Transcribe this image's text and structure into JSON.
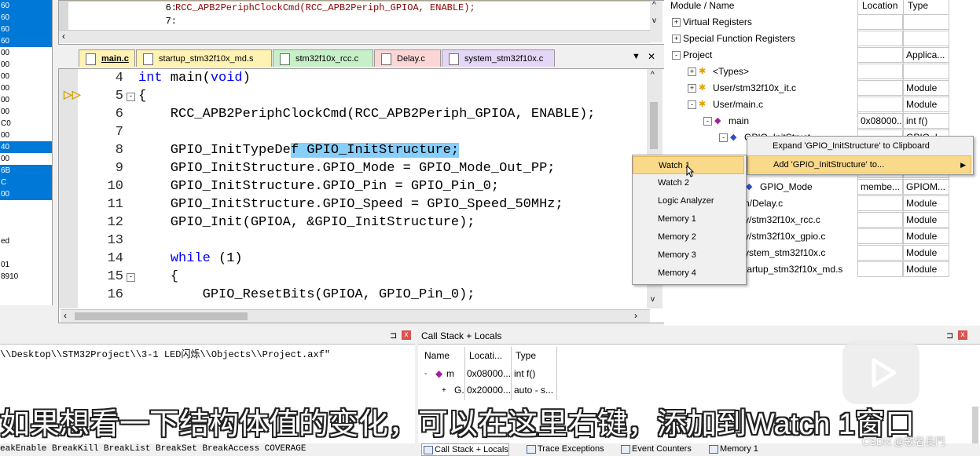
{
  "left_panel": {
    "rows": [
      {
        "text": "60",
        "selected": true
      },
      {
        "text": "60",
        "selected": true
      },
      {
        "text": "60",
        "selected": true
      },
      {
        "text": "60",
        "selected": true
      },
      {
        "text": "00",
        "selected": false
      },
      {
        "text": "00",
        "selected": false
      },
      {
        "text": "00",
        "selected": false
      },
      {
        "text": "00",
        "selected": false
      },
      {
        "text": "00",
        "selected": false
      },
      {
        "text": "00",
        "selected": false
      },
      {
        "text": "C0",
        "selected": false
      },
      {
        "text": "00",
        "selected": false
      },
      {
        "text": "40",
        "selected": true
      },
      {
        "text": "00",
        "selected": false
      },
      {
        "text": "6B",
        "selected": true
      },
      {
        "text": "C",
        "selected": true
      },
      {
        "text": "00",
        "selected": true
      },
      {
        "text": "",
        "selected": false
      },
      {
        "text": "",
        "selected": false
      },
      {
        "text": "",
        "selected": false
      },
      {
        "text": "ed",
        "selected": false
      },
      {
        "text": "",
        "selected": false
      },
      {
        "text": "01",
        "selected": false
      },
      {
        "text": "8910",
        "selected": false
      }
    ]
  },
  "top_editor": {
    "lines": [
      {
        "num": "6:",
        "code": "RCC_APB2PeriphClockCmd(RCC_APB2Periph_GPIOA, ENABLE);"
      },
      {
        "num": "7:",
        "code": ""
      }
    ]
  },
  "tabs": [
    {
      "label": "main.c",
      "color": "#fff2b3",
      "active": true
    },
    {
      "label": "startup_stm32f10x_md.s",
      "color": "#fff2b3",
      "active": false
    },
    {
      "label": "stm32f10x_rcc.c",
      "color": "#c8f0c8",
      "active": false
    },
    {
      "label": "Delay.c",
      "color": "#fcd6d6",
      "active": false
    },
    {
      "label": "system_stm32f10x.c",
      "color": "#e4d6f6",
      "active": false
    }
  ],
  "tab_controls": {
    "dropdown": "▼",
    "close": "✕"
  },
  "code": [
    {
      "num": "4",
      "parts": [
        {
          "t": "int",
          "k": true
        },
        {
          "t": " main(",
          "k": false
        },
        {
          "t": "void",
          "k": true
        },
        {
          "t": ")",
          "k": false
        }
      ]
    },
    {
      "num": "5",
      "parts": [
        {
          "t": "{",
          "k": false
        }
      ]
    },
    {
      "num": "6",
      "parts": [
        {
          "t": "    RCC_APB2PeriphClockCmd(RCC_APB2Periph_GPIOA, ENABLE);",
          "k": false
        }
      ]
    },
    {
      "num": "7",
      "parts": []
    },
    {
      "num": "8",
      "parts": [
        {
          "t": "    GPIO_InitTypeDe",
          "k": false
        },
        {
          "t": "f GPIO_InitStructure;",
          "k": false,
          "hl": true
        }
      ]
    },
    {
      "num": "9",
      "parts": [
        {
          "t": "    GPIO_InitStructure.GPIO_Mode = GPIO_Mode_Out_PP;",
          "k": false
        }
      ]
    },
    {
      "num": "10",
      "parts": [
        {
          "t": "    GPIO_InitStructure.GPIO_Pin = GPIO_Pin_0;",
          "k": false
        }
      ]
    },
    {
      "num": "11",
      "parts": [
        {
          "t": "    GPIO_InitStructure.GPIO_Speed = GPIO_Speed_50MHz;",
          "k": false
        }
      ]
    },
    {
      "num": "12",
      "parts": [
        {
          "t": "    GPIO_Init(GPIOA, &GPIO_InitStructure);",
          "k": false
        }
      ]
    },
    {
      "num": "13",
      "parts": []
    },
    {
      "num": "14",
      "parts": [
        {
          "t": "    ",
          "k": false
        },
        {
          "t": "while",
          "k": true
        },
        {
          "t": " (1)",
          "k": false
        }
      ]
    },
    {
      "num": "15",
      "parts": [
        {
          "t": "    {",
          "k": false
        }
      ]
    },
    {
      "num": "16",
      "parts": [
        {
          "t": "        GPIO_ResetBits(GPIOA, GPIO_Pin_0);",
          "k": false
        }
      ]
    }
  ],
  "symbols": {
    "headers": {
      "name": "Module / Name",
      "location": "Location",
      "type": "Type"
    },
    "rows": [
      {
        "indent": 0,
        "exp": "+",
        "icon": "",
        "name": "Virtual Registers",
        "loc": "",
        "type": ""
      },
      {
        "indent": 0,
        "exp": "+",
        "icon": "",
        "name": "Special Function Registers",
        "loc": "",
        "type": ""
      },
      {
        "indent": 0,
        "exp": "-",
        "icon": "",
        "name": "Project",
        "loc": "",
        "type": "Applica..."
      },
      {
        "indent": 1,
        "exp": "+",
        "icon": "module",
        "name": "<Types>",
        "loc": "",
        "type": ""
      },
      {
        "indent": 1,
        "exp": "+",
        "icon": "module",
        "name": "User/stm32f10x_it.c",
        "loc": "",
        "type": "Module"
      },
      {
        "indent": 1,
        "exp": "-",
        "icon": "module",
        "name": "User/main.c",
        "loc": "",
        "type": "Module"
      },
      {
        "indent": 2,
        "exp": "-",
        "icon": "func",
        "name": "main",
        "loc": "0x08000...",
        "type": "int f()"
      },
      {
        "indent": 3,
        "exp": "-",
        "icon": "var",
        "name": "GPIO_InitStruct...",
        "loc": "",
        "type": "GPIO_I..."
      },
      {
        "indent": 4,
        "exp": "",
        "icon": "",
        "name": "",
        "loc": "",
        "type": ""
      },
      {
        "indent": 4,
        "exp": "",
        "icon": "",
        "name": "",
        "loc": "",
        "type": ""
      },
      {
        "indent": 4,
        "exp": "",
        "icon": "var",
        "name": "GPIO_Mode",
        "loc": "membe...",
        "type": "GPIOM..."
      },
      {
        "indent": 0,
        "exp": "",
        "icon": "",
        "name": "n/Delay.c",
        "loc": "",
        "type": "Module"
      },
      {
        "indent": 0,
        "exp": "",
        "icon": "",
        "name": "y/stm32f10x_rcc.c",
        "loc": "",
        "type": "Module"
      },
      {
        "indent": 0,
        "exp": "",
        "icon": "",
        "name": "y/stm32f10x_gpio.c",
        "loc": "",
        "type": "Module"
      },
      {
        "indent": 0,
        "exp": "",
        "icon": "",
        "name": "ystem_stm32f10x.c",
        "loc": "",
        "type": "Module"
      },
      {
        "indent": 0,
        "exp": "",
        "icon": "",
        "name": "tartup_stm32f10x_md.s",
        "loc": "",
        "type": "Module"
      }
    ]
  },
  "context_menu": {
    "items": [
      "Expand 'GPIO_InitStructure' to Clipboard",
      "Add 'GPIO_InitStructure' to..."
    ],
    "arrow": "▶"
  },
  "submenu": {
    "items": [
      "Watch 1",
      "Watch 2",
      "Logic Analyzer",
      "Memory 1",
      "Memory 2",
      "Memory 3",
      "Memory 4"
    ]
  },
  "command_panel": {
    "title": "",
    "line": "\\\\Desktop\\\\STM32Project\\\\3-1 LED闪烁\\\\Objects\\\\Project.axf\"",
    "pin": "⊐",
    "close": "x",
    "status_line": "eakEnable BreakKill BreakList BreakSet BreakAccess COVERAGE"
  },
  "callstack": {
    "title": "Call Stack + Locals",
    "pin": "⊐",
    "close": "x",
    "headers": {
      "name": "Name",
      "loc": "Locati...",
      "type": "Type"
    },
    "rows": [
      {
        "exp": "-",
        "name": "m",
        "loc": "0x08000...",
        "type": "int f()"
      },
      {
        "exp": "+",
        "name": "G.",
        "loc": "0x20000...",
        "type": "auto - s..."
      }
    ]
  },
  "bottom_tabs": [
    "Call Stack + Locals",
    "Trace Exceptions",
    "Event Counters",
    "Memory 1"
  ],
  "subtitle": "如果想看一下结构体值的变化，可以在这里右键，添加到Watch 1窗口",
  "watermark": "CSDN @歌者長門"
}
